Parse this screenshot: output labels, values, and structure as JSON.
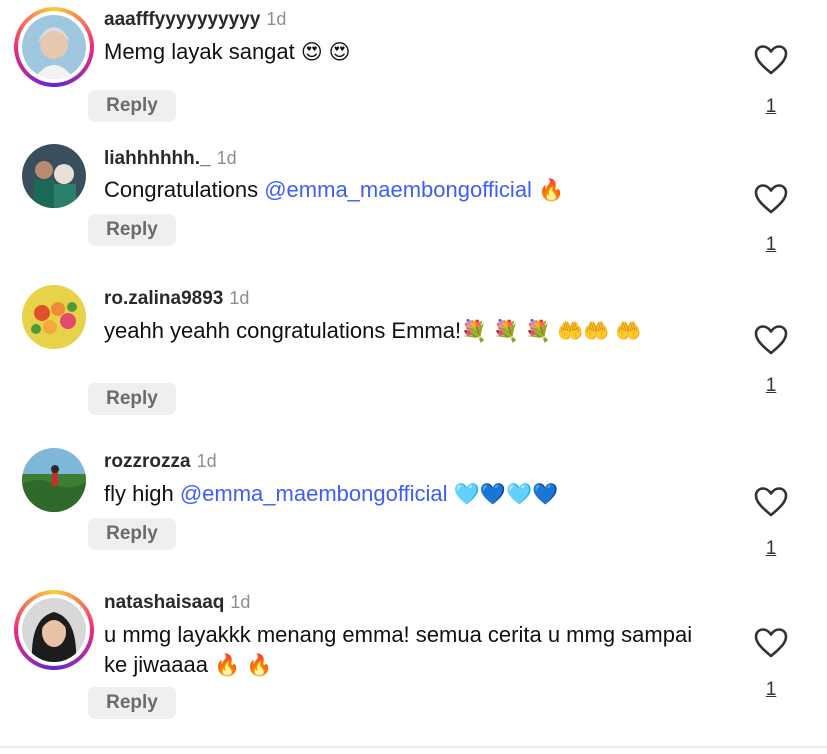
{
  "comments": [
    {
      "username": "aaafffyyyyyyyyyy",
      "time": "1d",
      "text": "Memg layak sangat ",
      "emojis": "😍 😍",
      "mention": "",
      "text_after": "",
      "reply_label": "Reply",
      "like_count": "1"
    },
    {
      "username": "liahhhhhh._",
      "time": "1d",
      "text": "Congratulations ",
      "mention": "@emma_maembongofficial",
      "emojis": "🔥",
      "reply_label": "Reply",
      "like_count": "1"
    },
    {
      "username": "ro.zalina9893",
      "time": "1d",
      "text": "yeahh yeahh congratulations Emma!",
      "emojis": "💐 💐 💐 🤲🤲 🤲",
      "mention": "",
      "reply_label": "Reply",
      "like_count": "1"
    },
    {
      "username": "rozzrozza",
      "time": "1d",
      "text": "fly high ",
      "mention": "@emma_maembongofficial",
      "emojis": "🩵💙🩵💙",
      "reply_label": "Reply",
      "like_count": "1"
    },
    {
      "username": "natashaisaaq",
      "time": "1d",
      "text": "u mmg layakkk menang emma! semua cerita u mmg sampai ke jiwaaaa",
      "emojis": "🔥 🔥",
      "mention": "",
      "reply_label": "Reply",
      "like_count": "1"
    }
  ],
  "icons": {
    "like": "heart-outline-icon"
  },
  "colors": {
    "mention": "#3f5ef5",
    "reply_bg": "#efefef",
    "time": "#8e8e8e"
  }
}
